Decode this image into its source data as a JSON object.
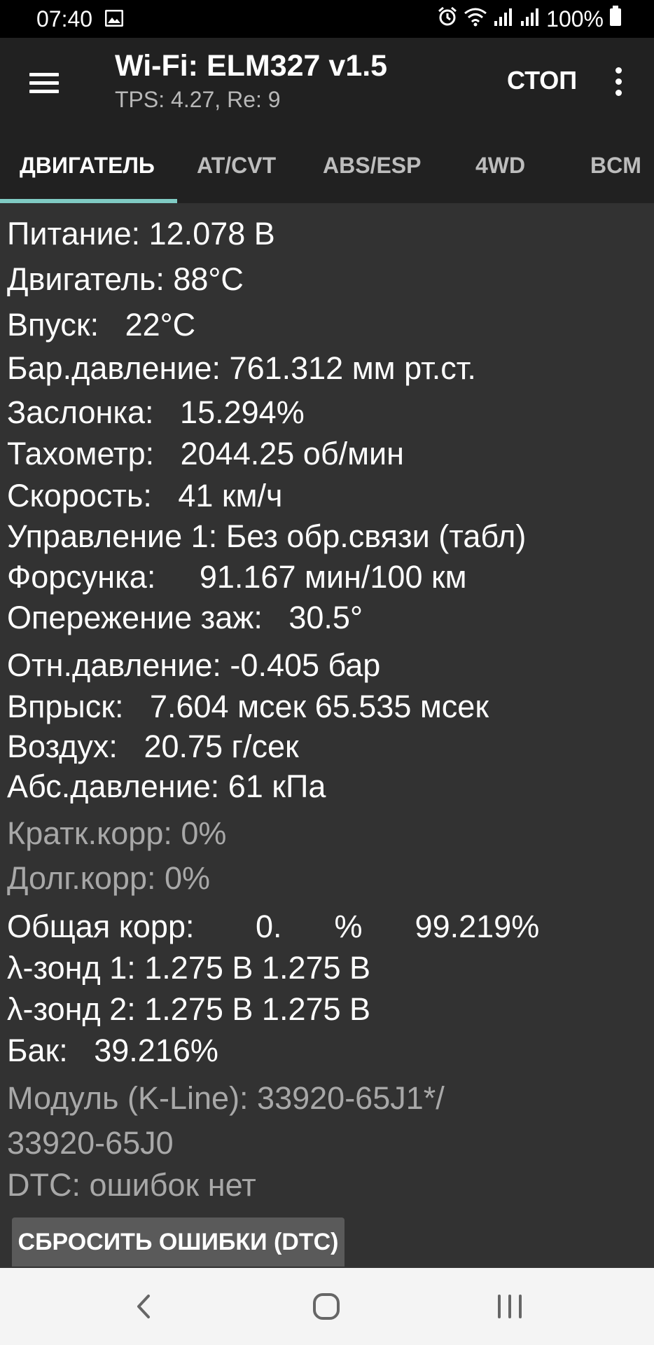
{
  "status_bar": {
    "time": "07:40",
    "battery": "100%",
    "icons": [
      "image-icon",
      "alarm-icon",
      "wifi-icon",
      "signal-icon",
      "signal-icon",
      "battery-icon"
    ]
  },
  "toolbar": {
    "title": "Wi-Fi: ELM327 v1.5",
    "subtitle": "TPS: 4.27, Re: 9",
    "stop_label": "СТОП"
  },
  "tabs": [
    {
      "label": "ДВИГАТЕЛЬ",
      "active": true
    },
    {
      "label": "AT/CVT"
    },
    {
      "label": "ABS/ESP"
    },
    {
      "label": "4WD"
    },
    {
      "label": "BCM"
    }
  ],
  "readings": [
    {
      "label": "Питание: 12.078 В"
    },
    {
      "label": "Двигатель: 88°C"
    },
    {
      "label": "Впуск:   22°C"
    },
    {
      "label": "Бар.давление: 761.312 мм рт.ст."
    },
    {
      "label": "Заслонка:   15.294%"
    },
    {
      "label": "Тахометр:   2044.25 об/мин"
    },
    {
      "label": "Скорость:   41 км/ч"
    },
    {
      "label": "Управление 1: Без обр.связи (табл)"
    },
    {
      "label": "Форсунка:     91.167 мин/100 км"
    },
    {
      "label": "Опережение заж:   30.5°"
    },
    {
      "label": "Отн.давление: -0.405 бар"
    },
    {
      "label": "Впрыск:   7.604 мсек 65.535 мсек"
    },
    {
      "label": "Воздух:   20.75 г/сек"
    },
    {
      "label": "Абс.давление: 61 кПа"
    },
    {
      "label": "Кратк.корр: 0%"
    },
    {
      "label": "Долг.корр: 0%"
    },
    {
      "label": "Общая корр:       0.      %      99.219%"
    },
    {
      "label": "λ-зонд 1: 1.275 В 1.275 В"
    },
    {
      "label": "λ-зонд 2: 1.275 В 1.275 В"
    },
    {
      "label": "Бак:   39.216%"
    },
    {
      "label": "Модуль (K-Line): 33920-65J1*/"
    },
    {
      "label": "33920-65J0"
    },
    {
      "label": "DTC: ошибок нет"
    }
  ],
  "reset_button_label": "СБРОСИТЬ ОШИБКИ (DTC)",
  "navbar": {
    "icons": [
      "back-icon",
      "home-icon",
      "recents-icon"
    ]
  },
  "colors": {
    "tab_indicator": "#80cbc4",
    "toolbar": "#212121",
    "background": "#323232"
  }
}
